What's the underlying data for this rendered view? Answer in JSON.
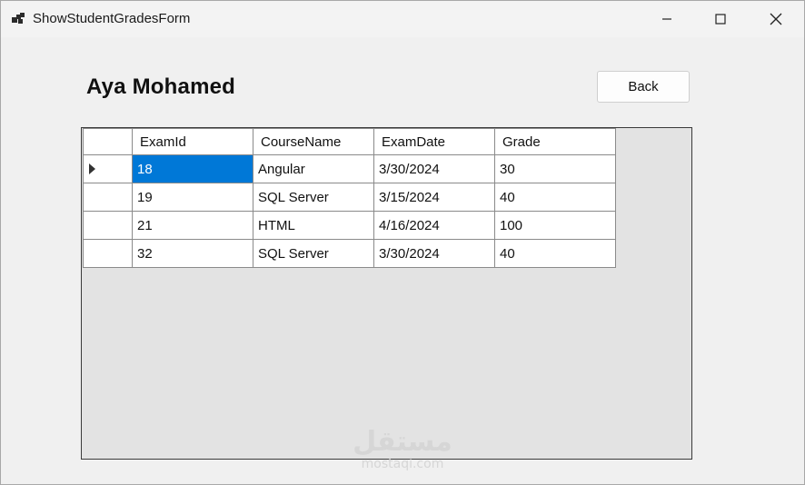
{
  "window": {
    "title": "ShowStudentGradesForm"
  },
  "header": {
    "student_name": "Aya Mohamed",
    "back_label": "Back"
  },
  "grid": {
    "columns": [
      "ExamId",
      "CourseName",
      "ExamDate",
      "Grade"
    ],
    "rows": [
      {
        "exam_id": "18",
        "course_name": "Angular",
        "exam_date": "3/30/2024",
        "grade": "30"
      },
      {
        "exam_id": "19",
        "course_name": "SQL Server",
        "exam_date": "3/15/2024",
        "grade": "40"
      },
      {
        "exam_id": "21",
        "course_name": "HTML",
        "exam_date": "4/16/2024",
        "grade": "100"
      },
      {
        "exam_id": "32",
        "course_name": "SQL Server",
        "exam_date": "3/30/2024",
        "grade": "40"
      }
    ],
    "selected_row": 0,
    "selection_color": "#0078d7"
  },
  "watermark": {
    "arabic": "مستقل",
    "latin": "mostaqi.com"
  }
}
